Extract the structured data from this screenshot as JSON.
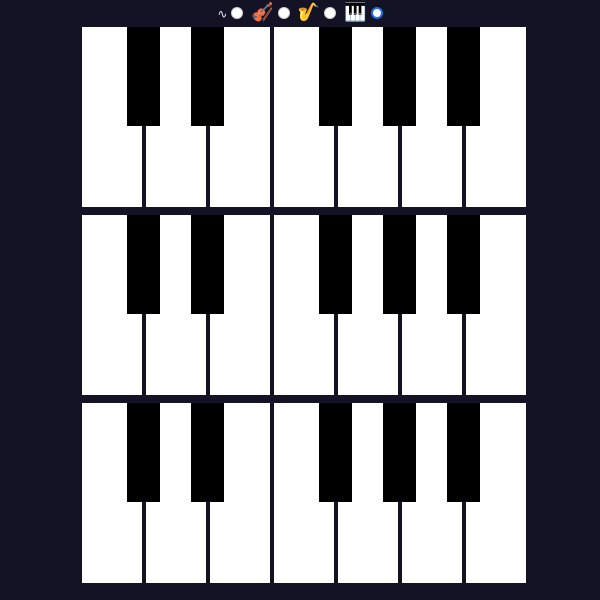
{
  "instrument_selector": {
    "options": [
      {
        "icon": "sine-wave-icon",
        "glyph": "∿",
        "selected": false
      },
      {
        "icon": "violin-icon",
        "glyph": "🎻",
        "selected": false
      },
      {
        "icon": "saxophone-icon",
        "glyph": "🎷",
        "selected": false
      },
      {
        "icon": "piano-icon",
        "glyph": "🎹",
        "selected": true
      }
    ],
    "selected_color": "#1a6fe6"
  },
  "keyboard": {
    "rows": 3,
    "white_keys_per_row": 7,
    "black_keys_per_row": 5,
    "background_color": "#141325",
    "white_key_color": "#ffffff",
    "black_key_color": "#000000"
  }
}
